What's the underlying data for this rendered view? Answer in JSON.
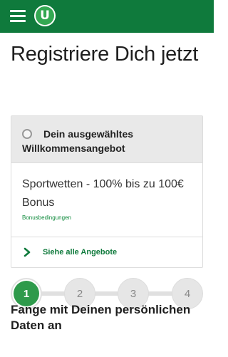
{
  "header": {
    "logo_letter": "U",
    "brand_color": "#0f7a3c",
    "menu_icon": "hamburger-icon"
  },
  "page": {
    "title": "Registriere Dich jetzt"
  },
  "offer": {
    "heading": "Dein ausgewähltes Willkommensangebot",
    "name": "Sportwetten - 100% bis zu 100€ Bonus",
    "terms_link": "Bonusbedingungen",
    "see_all": "Siehe alle Angebote"
  },
  "stepper": {
    "steps": [
      "1",
      "2",
      "3",
      "4"
    ],
    "active_step": 1,
    "active_color": "#2e9a4b"
  },
  "section": {
    "title": "Fange mit Deinen persönlichen Daten an"
  }
}
